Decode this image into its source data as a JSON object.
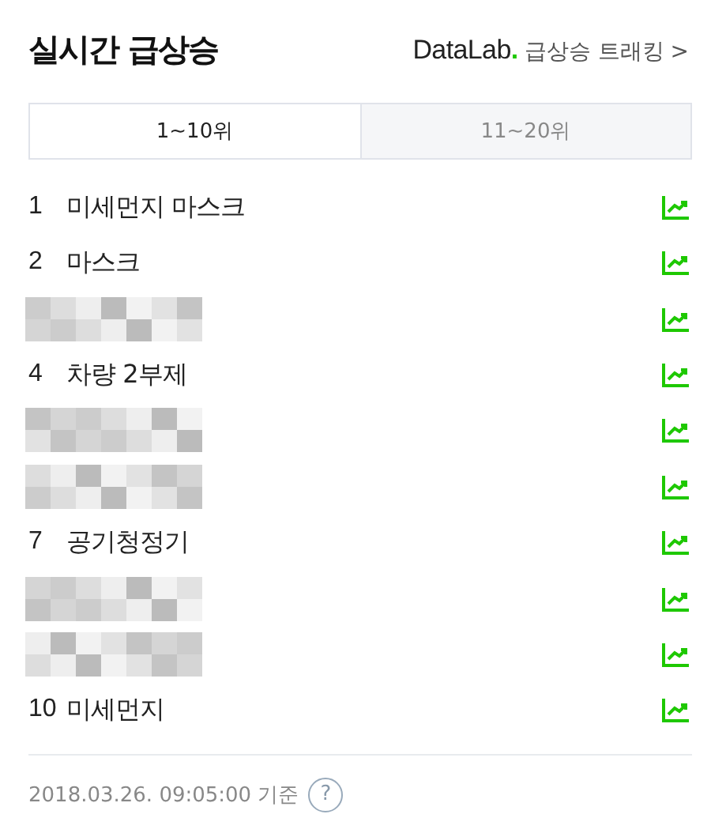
{
  "header": {
    "title": "실시간 급상승",
    "brand": "DataLab",
    "brand_dot": ".",
    "link": "급상승 트래킹",
    "link_arrow": ">"
  },
  "tabs": [
    {
      "label": "1~10위",
      "selected": true
    },
    {
      "label": "11~20위",
      "selected": false
    }
  ],
  "rows": [
    {
      "kind": "keyword",
      "rank": "1",
      "keyword": "미세먼지 마스크"
    },
    {
      "kind": "keyword",
      "rank": "2",
      "keyword": "마스크"
    },
    {
      "kind": "blurred"
    },
    {
      "kind": "keyword",
      "rank": "4",
      "keyword": "차량 2부제"
    },
    {
      "kind": "blurred"
    },
    {
      "kind": "blurred"
    },
    {
      "kind": "keyword",
      "rank": "7",
      "keyword": "공기청정기"
    },
    {
      "kind": "blurred"
    },
    {
      "kind": "blurred"
    },
    {
      "kind": "keyword",
      "rank": "10",
      "keyword": "미세먼지"
    }
  ],
  "footer": {
    "timestamp": "2018.03.26. 09:05:00 기준",
    "help": "?"
  }
}
